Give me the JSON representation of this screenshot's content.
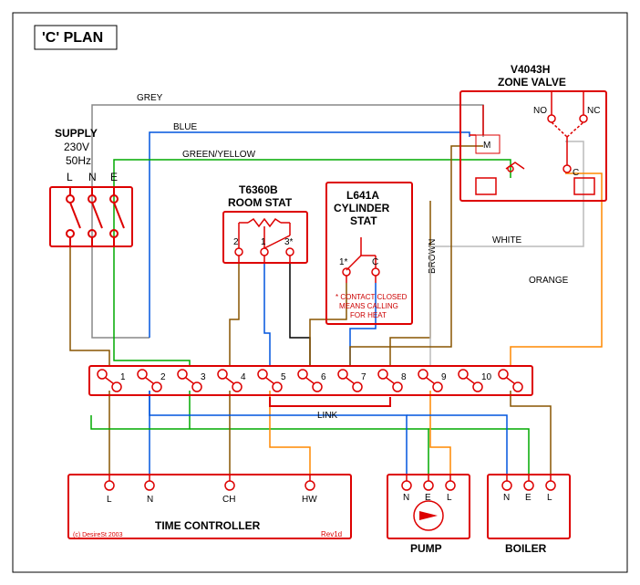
{
  "title": "'C' PLAN",
  "supply": {
    "label": "SUPPLY",
    "voltage": "230V",
    "freq": "50Hz",
    "L": "L",
    "N": "N",
    "E": "E"
  },
  "roomstat": {
    "label1": "T6360B",
    "label2": "ROOM STAT",
    "t1": "2",
    "t2": "1",
    "t3": "3*"
  },
  "cylstat": {
    "label1": "L641A",
    "label2": "CYLINDER",
    "label3": "STAT",
    "t1": "1*",
    "t2": "C",
    "note1": "* CONTACT CLOSED",
    "note2": "MEANS CALLING",
    "note3": "FOR HEAT"
  },
  "zonevalve": {
    "label1": "V4043H",
    "label2": "ZONE VALVE",
    "M": "M",
    "NO": "NO",
    "NC": "NC",
    "C": "C"
  },
  "junction": {
    "t1": "1",
    "t2": "2",
    "t3": "3",
    "t4": "4",
    "t5": "5",
    "t6": "6",
    "t7": "7",
    "t8": "8",
    "t9": "9",
    "t10": "10",
    "link": "LINK"
  },
  "timecontroller": {
    "label": "TIME CONTROLLER",
    "L": "L",
    "N": "N",
    "CH": "CH",
    "HW": "HW"
  },
  "pump": {
    "label": "PUMP",
    "N": "N",
    "E": "E",
    "L": "L"
  },
  "boiler": {
    "label": "BOILER",
    "N": "N",
    "E": "E",
    "L": "L"
  },
  "wires": {
    "grey": "GREY",
    "blue": "BLUE",
    "greenyellow": "GREEN/YELLOW",
    "brown": "BROWN",
    "white": "WHITE",
    "orange": "ORANGE"
  },
  "footer": {
    "copyright": "(c) DesireSt 2003",
    "rev": "Rev1d"
  }
}
